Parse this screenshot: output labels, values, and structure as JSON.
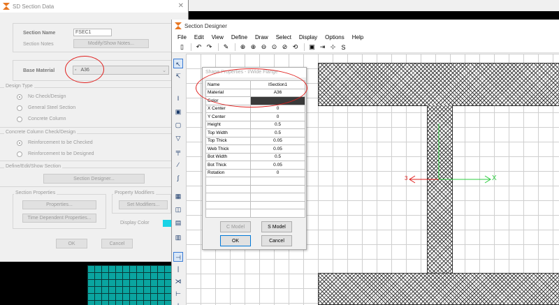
{
  "sd_dialog": {
    "title": "SD Section Data",
    "section_name_label": "Section Name",
    "section_name_value": "FSEC1",
    "section_notes_label": "Section Notes",
    "modify_notes_button": "Modify/Show Notes...",
    "base_material_label": "Base Material",
    "base_material_value": "A36",
    "design_type_title": "Design Type",
    "design_type_options": [
      "No Check/Design",
      "General Steel Section",
      "Concrete Column"
    ],
    "concrete_check_title": "Concrete Column Check/Design",
    "concrete_check_options": [
      "Reinforcement to be Checked",
      "Reinforcement to be Designed"
    ],
    "define_section_title": "Define/Edit/Show Section",
    "section_designer_button": "Section Designer...",
    "section_properties_title": "Section Properties",
    "properties_button": "Properties...",
    "time_dependent_button": "Time Dependent Properties...",
    "property_modifiers_title": "Property Modifiers",
    "set_modifiers_button": "Set Modifiers...",
    "display_color_label": "Display Color",
    "ok_button": "OK",
    "cancel_button": "Cancel",
    "display_color": "#19d3e6"
  },
  "section_designer": {
    "title": "Section Designer",
    "menu": [
      "File",
      "Edit",
      "View",
      "Define",
      "Draw",
      "Select",
      "Display",
      "Options",
      "Help"
    ],
    "axis_3_label": "3",
    "axis_x_label": "X"
  },
  "shape_properties": {
    "title": "Shape Properties - I/Wide Flange",
    "rows": [
      {
        "name": "Name",
        "value": "ISection1"
      },
      {
        "name": "Material",
        "value": "A36"
      },
      {
        "name": "Color",
        "value": ""
      },
      {
        "name": "X Center",
        "value": "0"
      },
      {
        "name": "Y Center",
        "value": "0"
      },
      {
        "name": "Height",
        "value": "0.5"
      },
      {
        "name": "Top Width",
        "value": "0.5"
      },
      {
        "name": "Top Thick",
        "value": "0.05"
      },
      {
        "name": "Web Thick",
        "value": "0.05"
      },
      {
        "name": "Bot Width",
        "value": "0.5"
      },
      {
        "name": "Bot Thick",
        "value": "0.05"
      },
      {
        "name": "Rotation",
        "value": "0"
      },
      {
        "name": "",
        "value": ""
      },
      {
        "name": "",
        "value": ""
      },
      {
        "name": "",
        "value": ""
      },
      {
        "name": "",
        "value": ""
      },
      {
        "name": "",
        "value": ""
      }
    ],
    "c_model_button": "C Model",
    "s_model_button": "S Model",
    "ok_button": "OK",
    "cancel_button": "Cancel"
  },
  "colors": {
    "annotation": "#e0201e",
    "axis_3": "#e0201e",
    "axis_x": "#2ecc40",
    "shape_color_cell": "#3a3a3a"
  }
}
